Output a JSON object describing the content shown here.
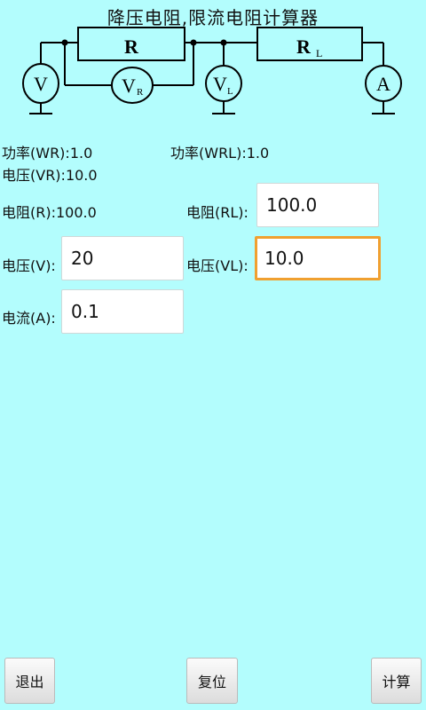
{
  "title": "降压电阻,限流电阻计算器",
  "circuit": {
    "r_label": "R",
    "rl_label": "R",
    "rl_sub": "L",
    "v_meter": "V",
    "vr_meter": "V",
    "vr_sub": "R",
    "vl_meter": "V",
    "vl_sub": "L",
    "a_meter": "A"
  },
  "results": {
    "power_wr": "功率(WR):1.0",
    "power_wrl": "功率(WRL):1.0",
    "voltage_vr": "电压(VR):10.0",
    "resistance_r": "电阻(R):100.0"
  },
  "inputs": {
    "rl_label": "电阻(RL):",
    "rl_value": "100.0",
    "v_label": "电压(V):",
    "v_value": "20",
    "vl_label": "电压(VL):",
    "vl_value": "10.0",
    "a_label": "电流(A):",
    "a_value": "0.1"
  },
  "buttons": {
    "exit": "退出",
    "reset": "复位",
    "calculate": "计算"
  },
  "colors": {
    "background": "#b3fdfd",
    "focus_border": "#f0a030"
  }
}
